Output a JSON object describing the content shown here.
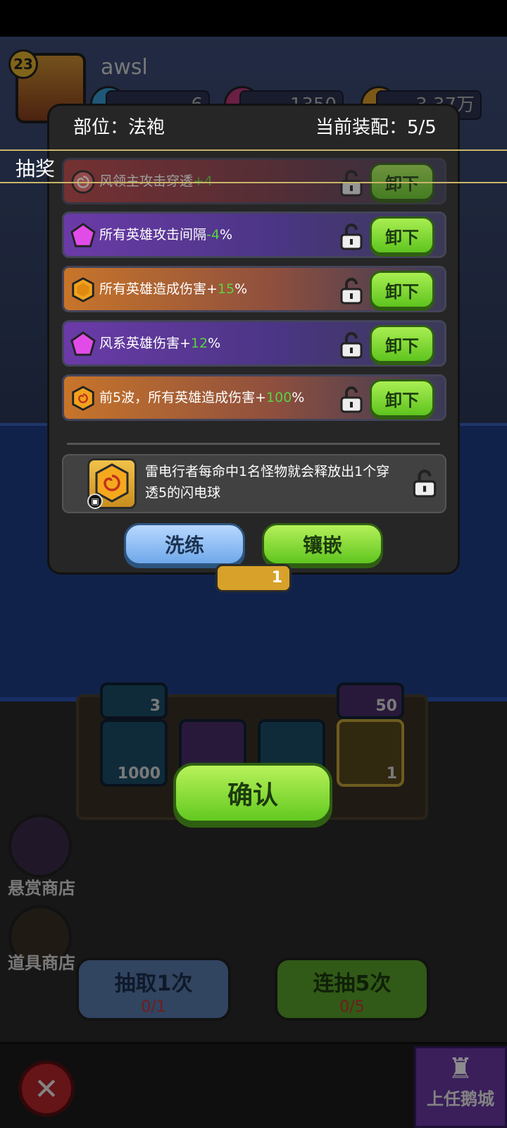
{
  "player": {
    "level": "23",
    "name": "awsl",
    "resources": [
      "6",
      "1350",
      "3.37万"
    ]
  },
  "draw_tab_label": "抽奖",
  "modal": {
    "slot_label": "部位：法袍",
    "equipped_label": "当前装配：5/5",
    "rows": [
      {
        "text": "风领主攻击穿透",
        "value": "+4",
        "suffix": "",
        "style": "red",
        "gem": "spiral-red",
        "button": "卸下"
      },
      {
        "text": "所有英雄攻击间隔",
        "value": "-4",
        "suffix": "%",
        "style": "purple",
        "gem": "pentagon-purple",
        "button": "卸下"
      },
      {
        "text": "所有英雄造成伤害+",
        "value": "15",
        "suffix": "%",
        "style": "orange",
        "gem": "hexagon-orange",
        "button": "卸下"
      },
      {
        "text": "风系英雄伤害+",
        "value": "12",
        "suffix": "%",
        "style": "purple",
        "gem": "pentagon-purple",
        "button": "卸下"
      },
      {
        "text": "前5波，所有英雄造成伤害+",
        "value": "100",
        "suffix": "%",
        "style": "orange",
        "gem": "spiral-orange",
        "button": "卸下"
      }
    ],
    "skill_text": "雷电行者每命中1名怪物就会释放出1个穿透5的闪电球",
    "refine_label": "洗练",
    "inlay_label": "镶嵌"
  },
  "under_badge_count": "1",
  "background": {
    "slot_counts": [
      "1000",
      "1"
    ],
    "top_counts": [
      "3",
      "50"
    ],
    "confirm_label": "确认",
    "bounty_shop_label": "悬赏商店",
    "item_shop_label": "道具商店",
    "draw_once": {
      "label": "抽取1次",
      "cost": "0/1"
    },
    "draw_five": {
      "label": "连抽5次",
      "cost": "0/5"
    },
    "castle_label": "上任鹅城"
  },
  "colors": {
    "unequip_green": "#6fd12a",
    "purple_row": "#6b3ba8",
    "orange_row": "#c8752a",
    "value_green": "#5bd33f"
  }
}
